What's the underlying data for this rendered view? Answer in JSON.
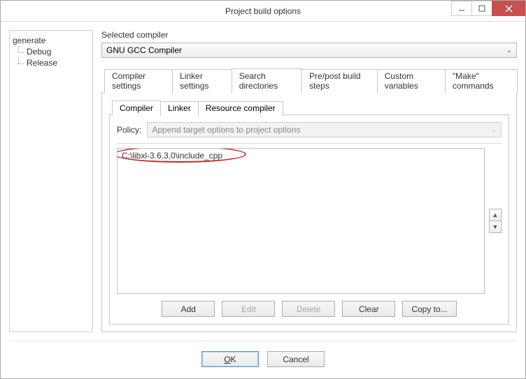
{
  "window": {
    "title": "Project build options"
  },
  "tree": {
    "root": "generate",
    "children": [
      "Debug",
      "Release"
    ]
  },
  "compiler": {
    "group_label": "Selected compiler",
    "selected": "GNU GCC Compiler"
  },
  "tabs": [
    "Compiler settings",
    "Linker settings",
    "Search directories",
    "Pre/post build steps",
    "Custom variables",
    "\"Make\" commands"
  ],
  "active_tab": 2,
  "subtabs": [
    "Compiler",
    "Linker",
    "Resource compiler"
  ],
  "active_subtab": 0,
  "policy": {
    "label": "Policy:",
    "value": "Append target options to project options"
  },
  "paths": [
    "C:\\libxl-3.6.3.0\\include_cpp"
  ],
  "path_buttons": {
    "add": "Add",
    "edit": "Edit",
    "delete": "Delete",
    "clear": "Clear",
    "copy": "Copy to..."
  },
  "dialog_buttons": {
    "ok": "OK",
    "cancel": "Cancel"
  }
}
